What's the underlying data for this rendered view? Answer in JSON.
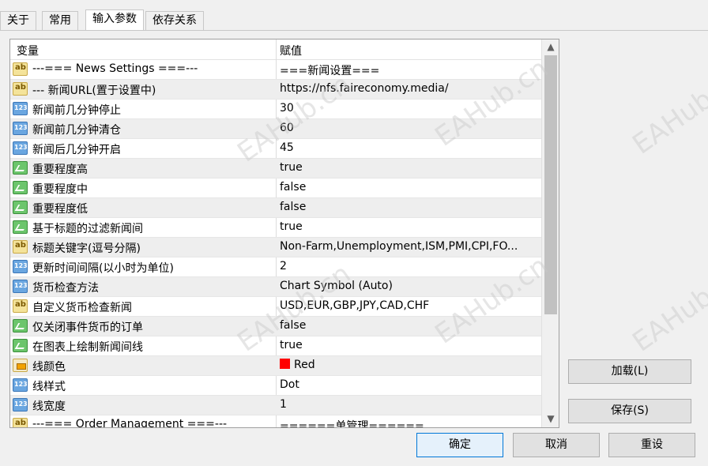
{
  "tabs": [
    "关于",
    "常用",
    "输入参数",
    "依存关系"
  ],
  "grid": {
    "col_variable": "变量",
    "col_value": "赋值",
    "rows": [
      {
        "icon": "ab",
        "name": "---=== News Settings ===---",
        "value": "===新闻设置==="
      },
      {
        "icon": "ab",
        "name": "--- 新闻URL(置于设置中)",
        "value": "https://nfs.faireconomy.media/"
      },
      {
        "icon": "num",
        "name": "新闻前几分钟停止",
        "value": "30"
      },
      {
        "icon": "num",
        "name": "新闻前几分钟清仓",
        "value": "60"
      },
      {
        "icon": "num",
        "name": "新闻后几分钟开启",
        "value": "45"
      },
      {
        "icon": "bool",
        "name": "重要程度高",
        "value": "true"
      },
      {
        "icon": "bool",
        "name": "重要程度中",
        "value": "false"
      },
      {
        "icon": "bool",
        "name": "重要程度低",
        "value": "false"
      },
      {
        "icon": "bool",
        "name": "基于标题的过滤新闻间",
        "value": "true"
      },
      {
        "icon": "ab",
        "name": "标题关键字(逗号分隔)",
        "value": "Non-Farm,Unemployment,ISM,PMI,CPI,FO..."
      },
      {
        "icon": "num",
        "name": "更新时间间隔(以小时为单位)",
        "value": "2"
      },
      {
        "icon": "num",
        "name": "货币检查方法",
        "value": "Chart Symbol (Auto)"
      },
      {
        "icon": "ab",
        "name": "自定义货币检查新闻",
        "value": "USD,EUR,GBP,JPY,CAD,CHF"
      },
      {
        "icon": "bool",
        "name": "仅关闭事件货币的订单",
        "value": "false"
      },
      {
        "icon": "bool",
        "name": "在图表上绘制新闻间线",
        "value": "true"
      },
      {
        "icon": "color",
        "name": "线颜色",
        "value": "Red"
      },
      {
        "icon": "num",
        "name": "线样式",
        "value": "Dot"
      },
      {
        "icon": "num",
        "name": "线宽度",
        "value": "1"
      },
      {
        "icon": "ab",
        "name": "---=== Order Management ===---",
        "value": "======单管理======"
      }
    ]
  },
  "colors": {
    "line_color_swatch": "#ff0000",
    "accent": "#0078d7"
  },
  "buttons": {
    "load": "加载(L)",
    "save": "保存(S)",
    "ok": "确定",
    "cancel": "取消",
    "reset": "重设"
  },
  "watermark": "EAHub.cn"
}
